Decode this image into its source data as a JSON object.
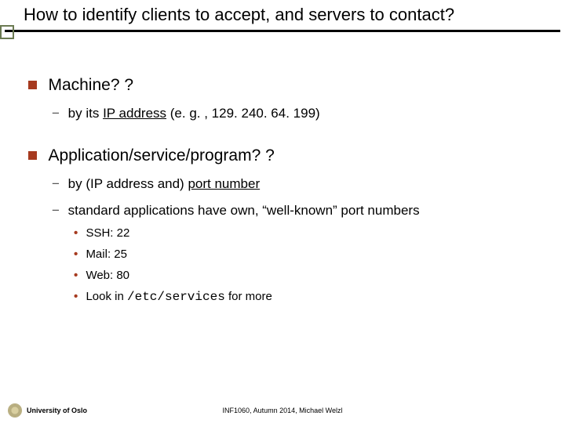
{
  "title": "How to identify clients to accept, and servers to contact?",
  "sections": [
    {
      "heading": "Machine? ?",
      "items": [
        {
          "pre": "by its ",
          "u": "IP address",
          "post": " (e. g. , 129. 240. 64. 199)"
        }
      ]
    },
    {
      "heading": "Application/service/program? ?",
      "items": [
        {
          "pre": "by (IP address and) ",
          "u": "port number",
          "post": ""
        },
        {
          "pre": "standard applications have own, “well-known” port numbers",
          "sub": [
            "SSH: 22",
            "Mail: 25",
            "Web: 80",
            {
              "pre": "Look in ",
              "code": "/etc/services",
              "post": " for more"
            }
          ]
        }
      ]
    }
  ],
  "footer": {
    "left": "University of Oslo",
    "center": "INF1060, Autumn 2014, Michael Welzl"
  }
}
